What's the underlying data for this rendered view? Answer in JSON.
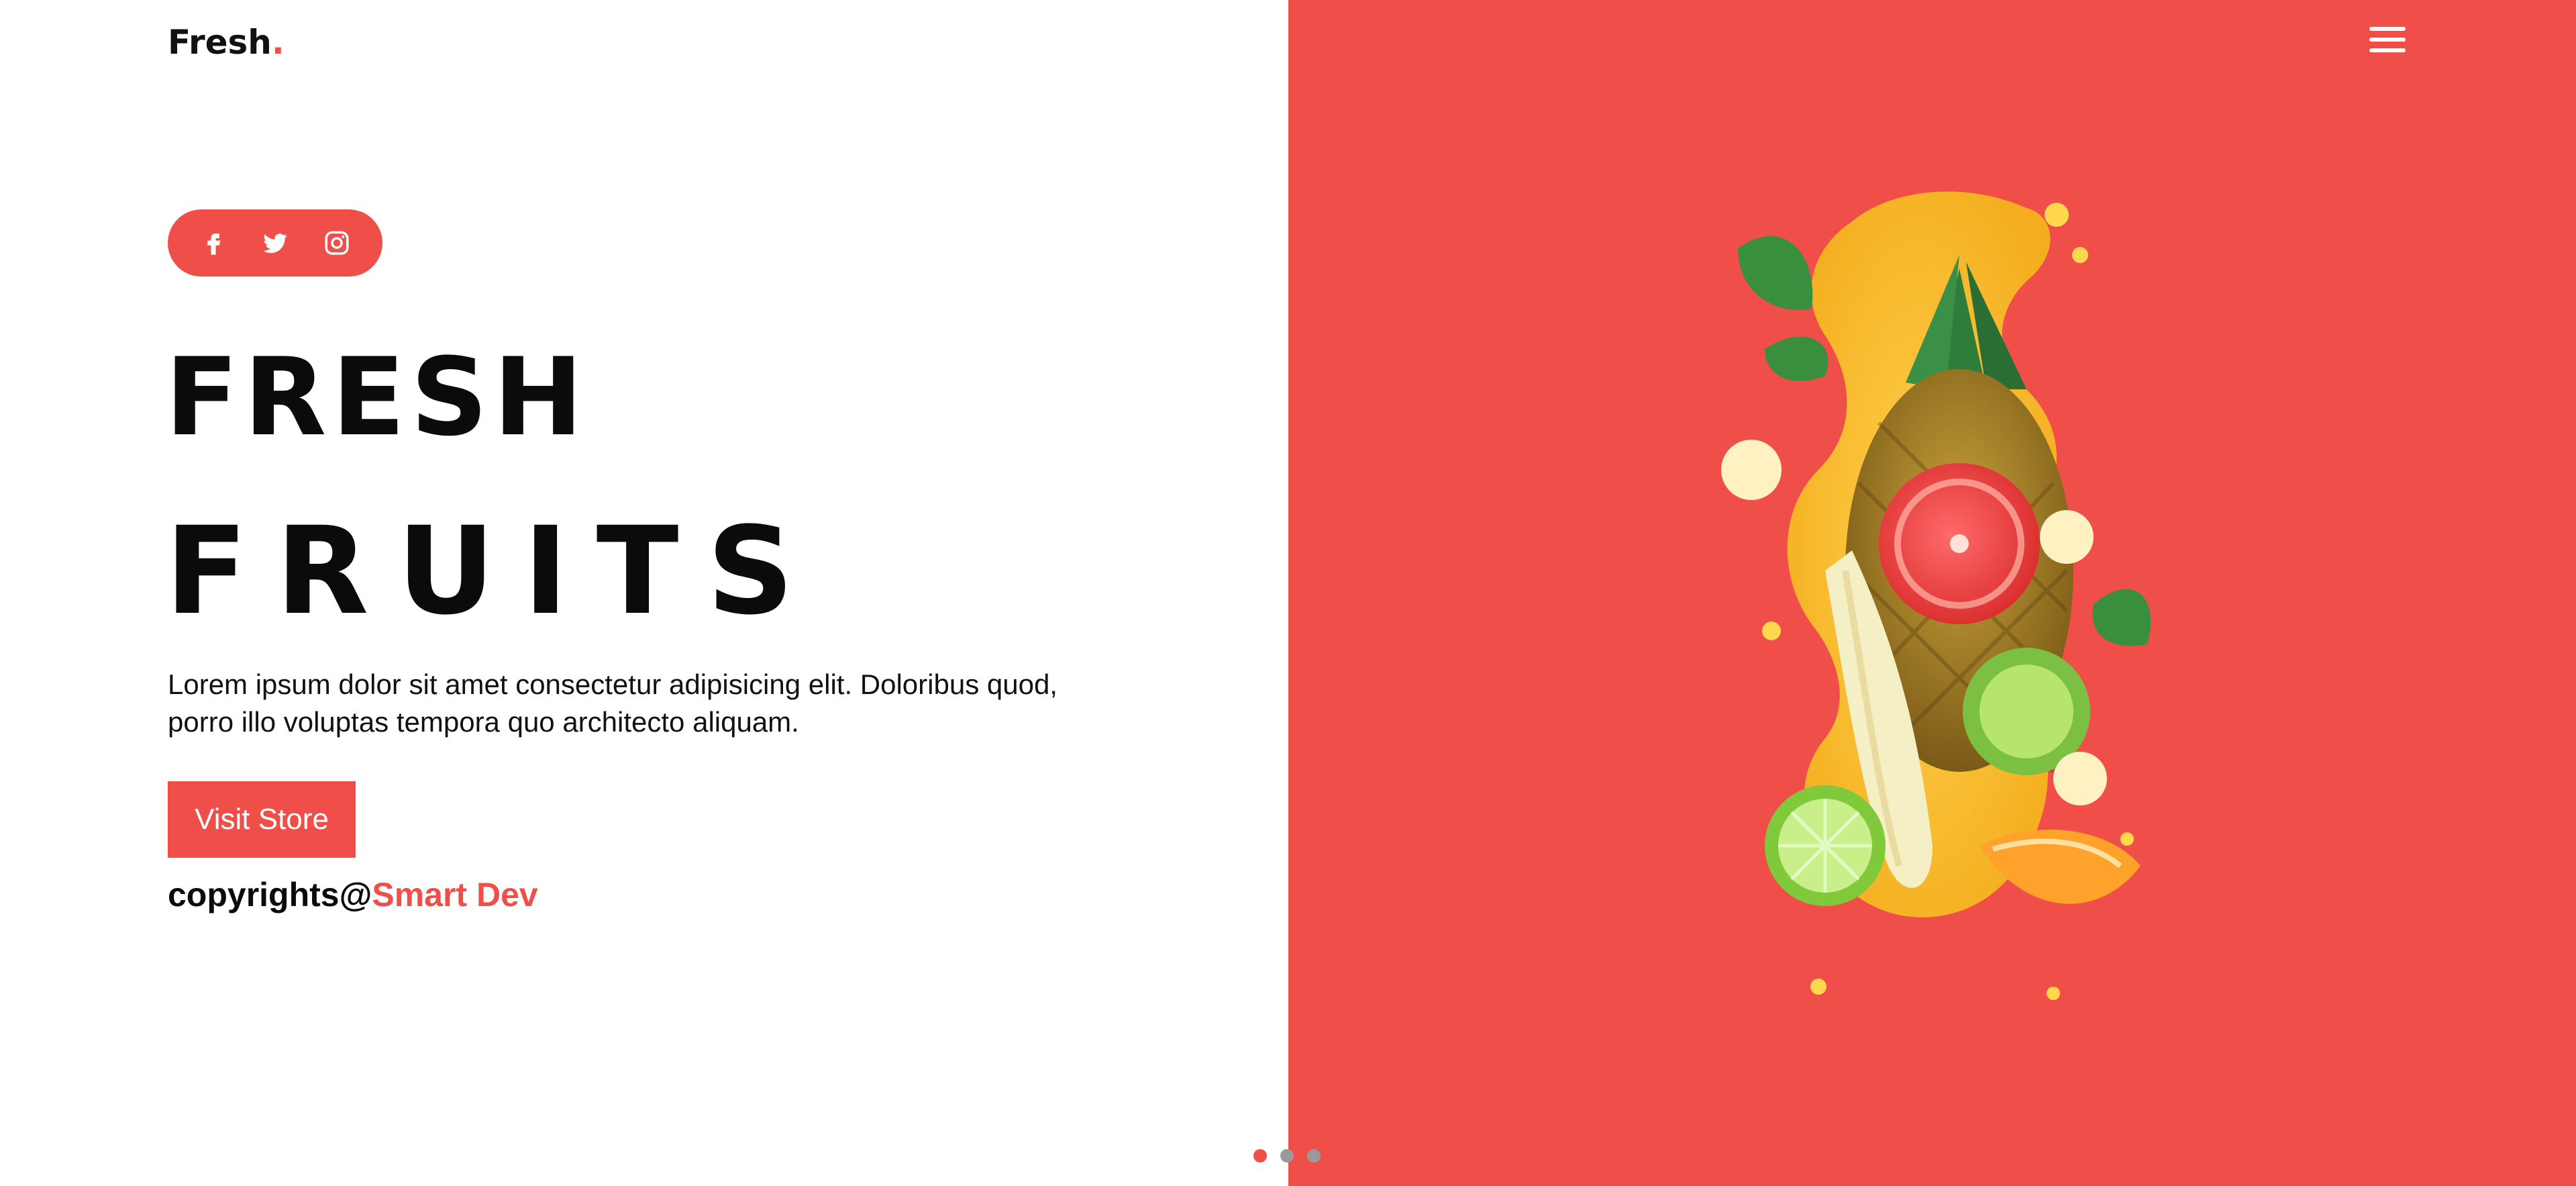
{
  "header": {
    "logo_text": "Fresh",
    "logo_dot": ".",
    "menu_icon": "hamburger-menu-icon"
  },
  "social": {
    "icons": [
      "facebook-icon",
      "twitter-icon",
      "instagram-icon"
    ]
  },
  "hero": {
    "title_line_1": "FRESH",
    "title_line_2": "FRUITS",
    "description": "Lorem ipsum dolor sit amet consectetur adipisicing elit. Doloribus quod, porro illo voluptas tempora quo architecto aliquam.",
    "cta_label": "Visit Store",
    "copyright_prefix": "copyrights@",
    "copyright_brand": "Smart Dev"
  },
  "pagination": {
    "count": 3,
    "active_index": 0
  },
  "colors": {
    "accent": "#f04f49",
    "text": "#0b0b0b",
    "background": "#ffffff"
  }
}
